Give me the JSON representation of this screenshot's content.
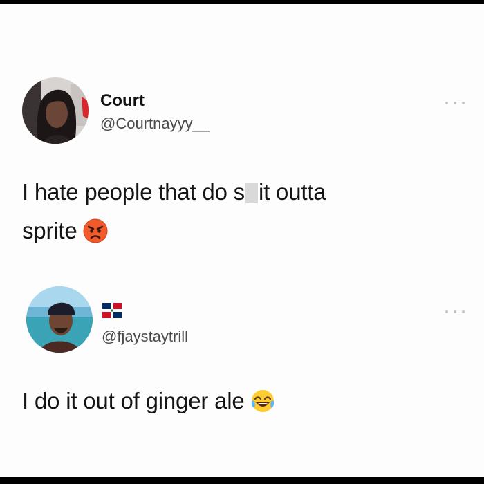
{
  "tweet1": {
    "display_name": "Court",
    "handle": "@Courtnayyy__",
    "text_line1_part1": "I hate people that do s",
    "text_line1_part2": "it outta",
    "text_line2": "sprite",
    "avatar_icon": "profile-photo-woman",
    "emoji": "angry-face-emoji",
    "more_icon": "more-options-icon"
  },
  "tweet2": {
    "flag_icon": "dominican-republic-flag-icon",
    "handle": "@fjaystaytrill",
    "text": "I do it out of ginger ale",
    "avatar_icon": "profile-photo-man",
    "emoji": "face-with-tears-of-joy-emoji",
    "more_icon": "more-options-icon"
  },
  "colors": {
    "background": "#fdfdfd",
    "frame": "#000000",
    "text": "#141414",
    "handle": "#4a4a4a",
    "flag_blue": "#002d62",
    "flag_red": "#ce1126"
  }
}
